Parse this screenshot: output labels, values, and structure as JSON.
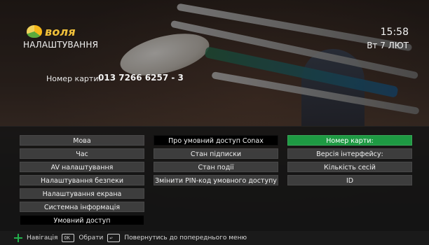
{
  "header": {
    "logo_text": "воля",
    "page_title": "НАЛАШТУВАННЯ",
    "time": "15:58",
    "date": "Вт 7 ЛЮТ"
  },
  "card": {
    "label": "Номер карти:",
    "value": "013 7266 6257 - 3"
  },
  "menu": {
    "left": [
      "Мова",
      "Час",
      "AV налаштування",
      "Налаштування безпеки",
      "Налаштування екрана",
      "Системна інформація",
      "Умовний доступ"
    ],
    "left_selected_index": 6,
    "middle": [
      "Про умовний доступ Conax",
      "Стан підписки",
      "Стан події",
      "Змінити PIN-код умовного доступу"
    ],
    "middle_selected_index": 0,
    "right": [
      "Номер карти:",
      "Версія інтерфейсу:",
      "Кількість сесій",
      "ID"
    ],
    "right_highlight_index": 0,
    "highlight_color": "#1e9a43"
  },
  "hint_bar": {
    "nav_label": "Навігація",
    "ok_label": "Обрати",
    "back_label": "Повернутись до попереднього меню",
    "ok_icon": "ok-button-icon",
    "back_icon": "back-button-icon"
  }
}
